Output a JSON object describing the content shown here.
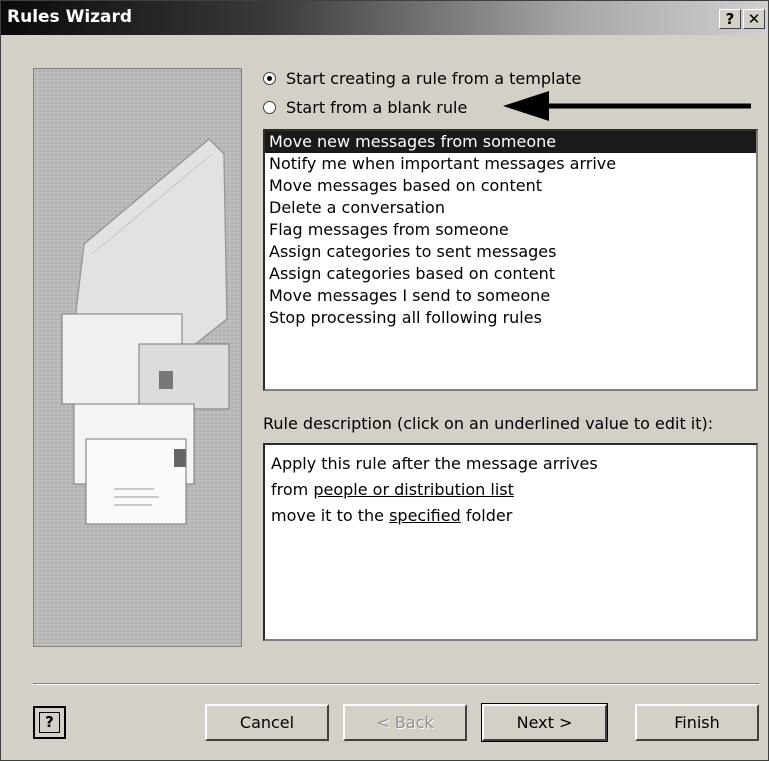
{
  "window": {
    "title": "Rules Wizard",
    "help_button": "?",
    "close_button": "✕"
  },
  "options": {
    "template": "Start creating a rule from a template",
    "blank": "Start from a blank rule",
    "selected": "template"
  },
  "templates": [
    "Move new messages from someone",
    "Notify me when important messages arrive",
    "Move messages based on content",
    "Delete a conversation",
    "Flag messages from someone",
    "Assign categories to sent messages",
    "Assign categories based on content",
    "Move messages I send to someone",
    "Stop processing all following rules"
  ],
  "selected_template_index": 0,
  "description": {
    "label": "Rule description (click on an underlined value to edit it):",
    "line1": "Apply this rule after the message arrives",
    "line2_prefix": "from ",
    "line2_link": "people or distribution list",
    "line3_prefix": "move it to the ",
    "line3_link": "specified",
    "line3_suffix": " folder"
  },
  "buttons": {
    "help": "?",
    "cancel": "Cancel",
    "back": "< Back",
    "next": "Next >",
    "finish": "Finish"
  }
}
